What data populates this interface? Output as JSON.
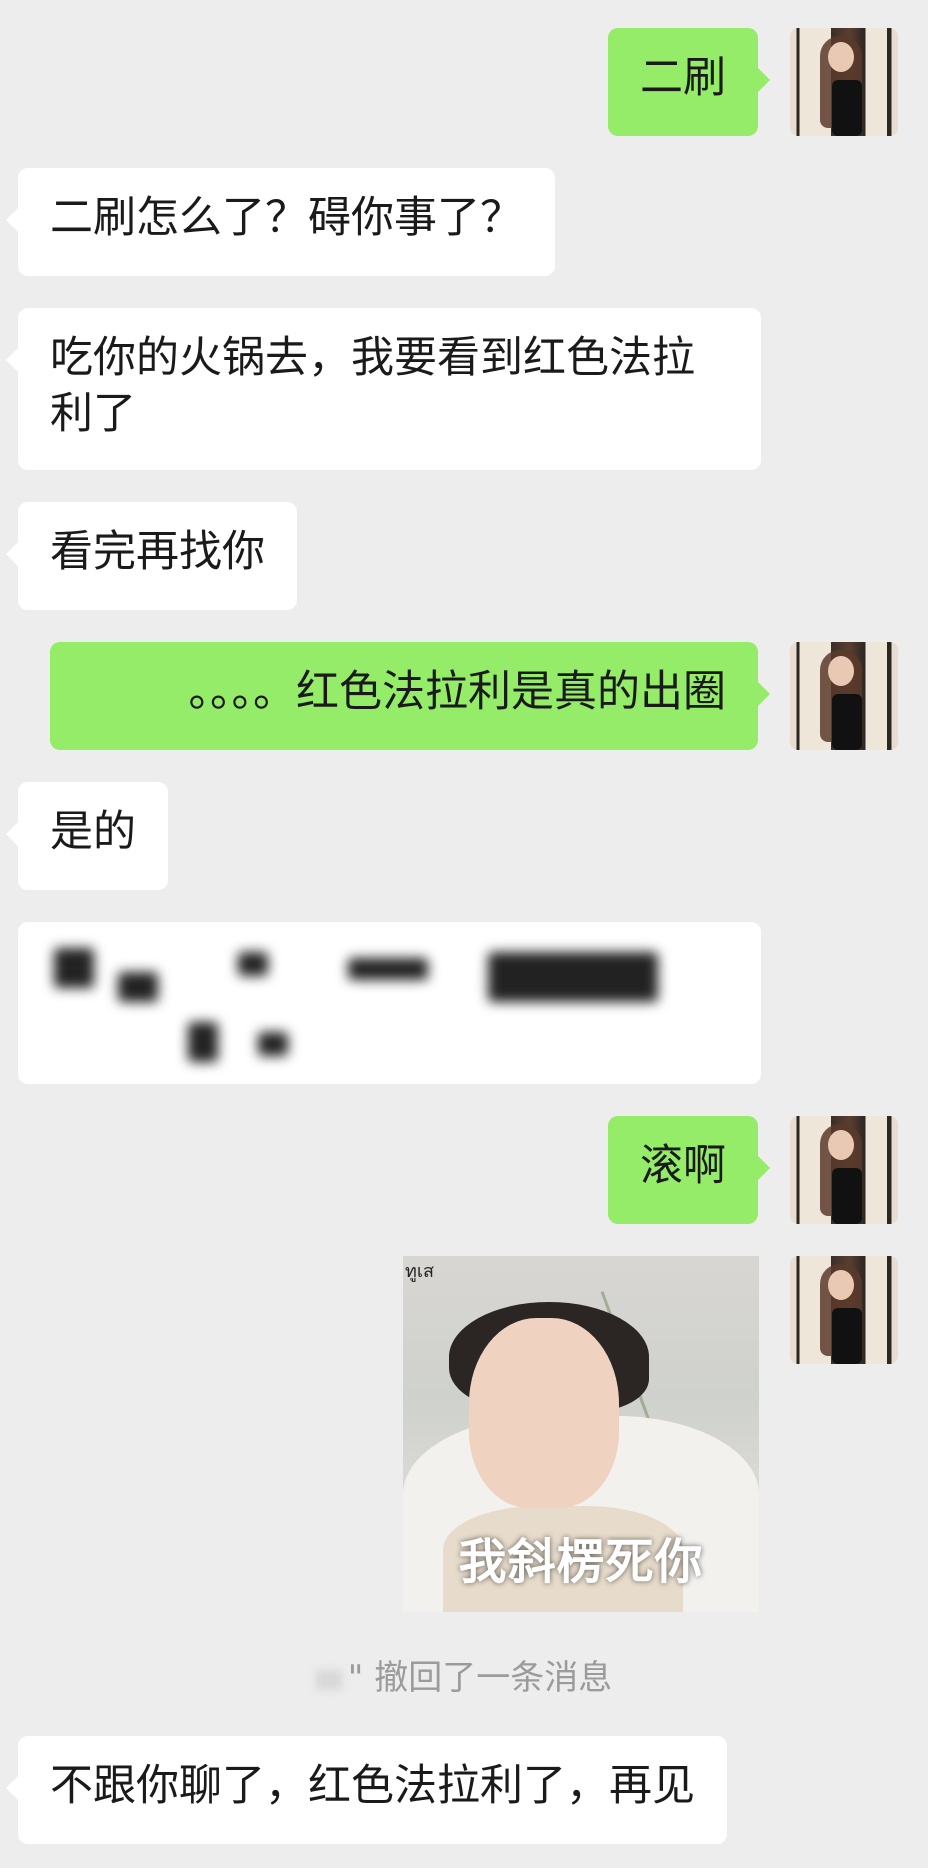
{
  "messages": [
    {
      "id": "m1",
      "side": "out",
      "text": "二刷"
    },
    {
      "id": "m2",
      "side": "in",
      "text": "二刷怎么了？碍你事了？"
    },
    {
      "id": "m3",
      "side": "in",
      "text": "吃你的火锅去，我要看到红色法拉利了"
    },
    {
      "id": "m4",
      "side": "in",
      "text": "看完再找你"
    },
    {
      "id": "m5",
      "side": "out",
      "text": "。。。。红色法拉利是真的出圈"
    },
    {
      "id": "m6",
      "side": "in",
      "text": "是的"
    },
    {
      "id": "m7",
      "side": "in",
      "text": "",
      "blurred": true
    },
    {
      "id": "m8",
      "side": "out",
      "text": "滚啊"
    },
    {
      "id": "m9",
      "side": "out",
      "type": "sticker",
      "caption": "我斜楞死你",
      "logo": "ทูเส"
    },
    {
      "id": "m10",
      "side": "in",
      "text": "不跟你聊了，红色法拉利了，再见"
    }
  ],
  "system_notice": {
    "suffix": "\" 撤回了一条消息"
  }
}
